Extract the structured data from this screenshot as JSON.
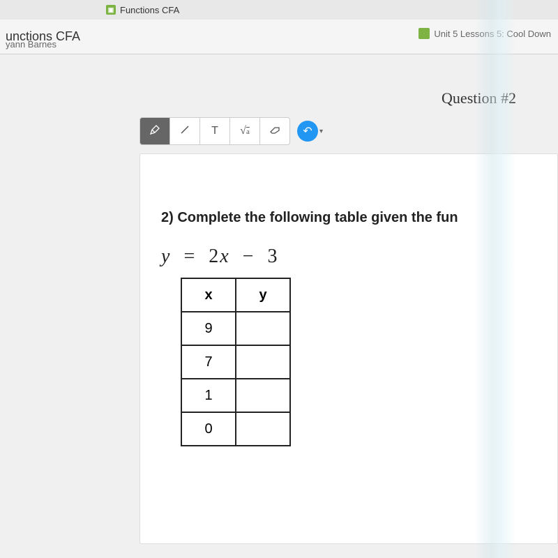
{
  "browser": {
    "tab_title": "Functions CFA"
  },
  "header": {
    "title": "unctions CFA",
    "user": "yann Barnes",
    "unit": "Unit 5 Lessons 5: Cool Down"
  },
  "question": {
    "label": "Question #2",
    "prompt": "2) Complete the following table given the fun",
    "equation_y": "y",
    "equation_eq": "=",
    "equation_coef": "2",
    "equation_x": "x",
    "equation_minus": "−",
    "equation_const": "3"
  },
  "toolbar": {
    "pen": "✎",
    "line": "╱",
    "text": "T",
    "math": "√",
    "eraser": "⌫",
    "undo": "↶",
    "caret": "▾"
  },
  "chart_data": {
    "type": "table",
    "columns": [
      "x",
      "y"
    ],
    "rows": [
      {
        "x": "9",
        "y": ""
      },
      {
        "x": "7",
        "y": ""
      },
      {
        "x": "1",
        "y": ""
      },
      {
        "x": "0",
        "y": ""
      }
    ]
  }
}
